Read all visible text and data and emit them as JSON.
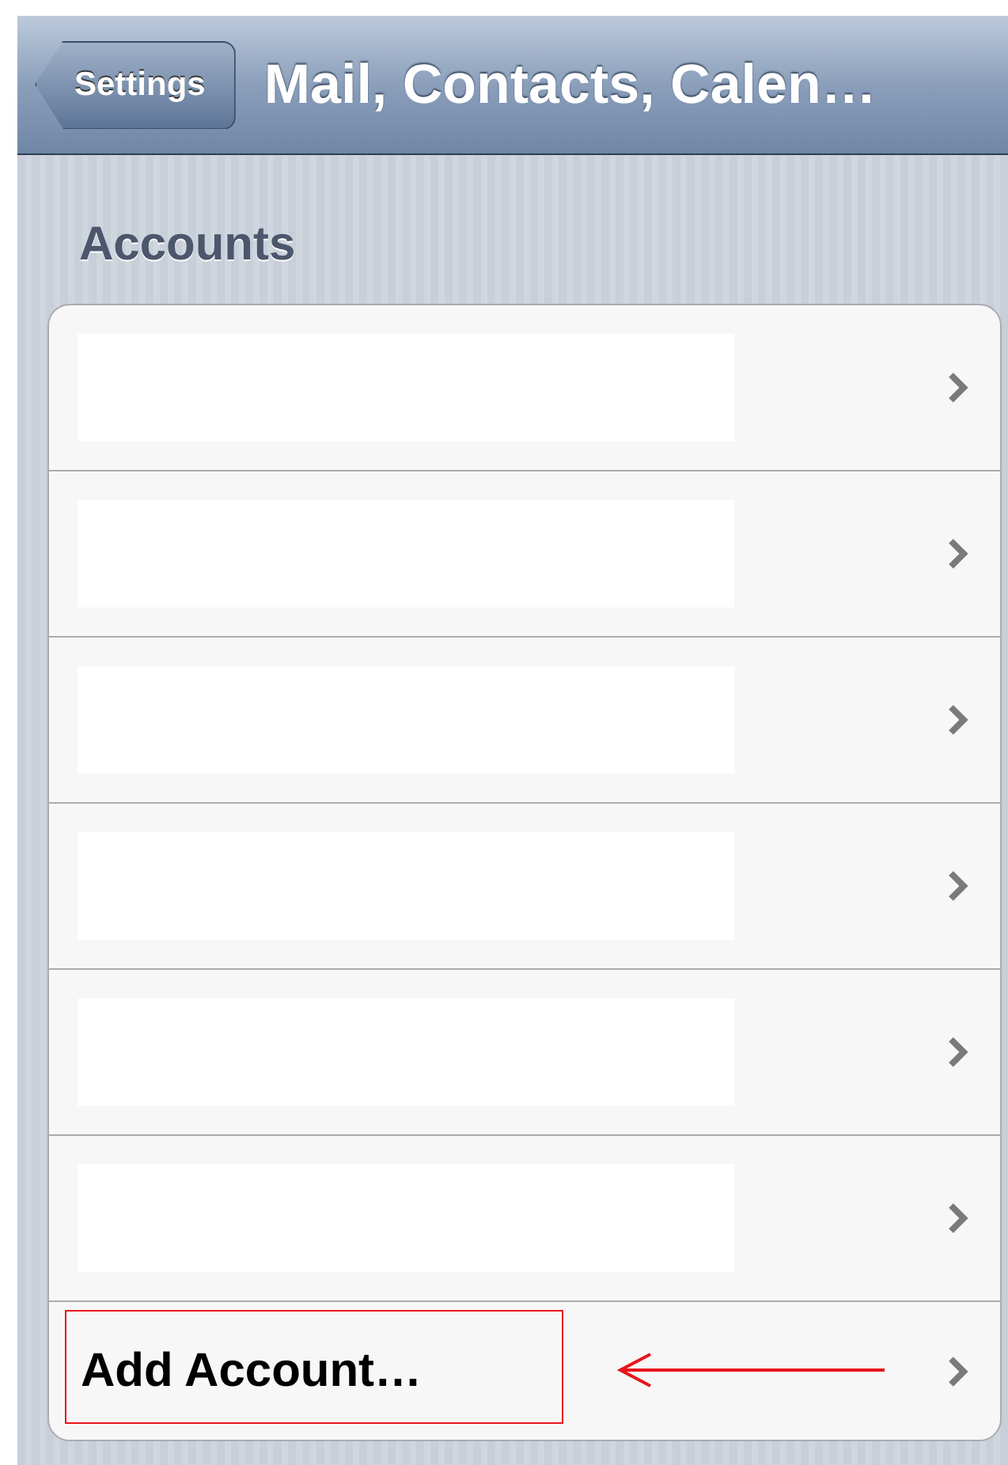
{
  "nav_bar": {
    "back_button": "Settings",
    "title": "Mail, Contacts, Calen…"
  },
  "section_header": "Accounts",
  "rows": [
    {
      "kind": "redacted"
    },
    {
      "kind": "redacted"
    },
    {
      "kind": "redacted"
    },
    {
      "kind": "redacted"
    },
    {
      "kind": "redacted"
    },
    {
      "kind": "redacted"
    },
    {
      "kind": "action",
      "label": "Add Account…",
      "highlighted": true
    }
  ]
}
